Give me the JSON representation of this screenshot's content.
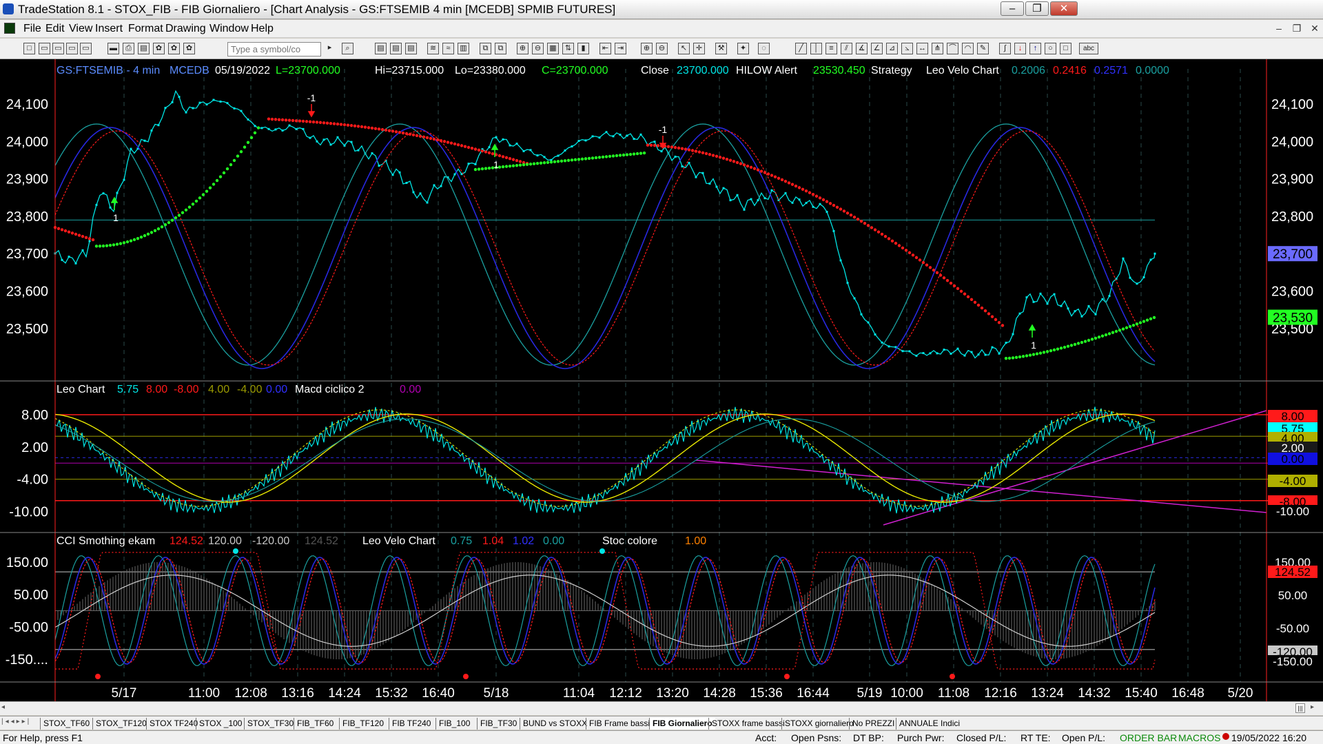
{
  "window": {
    "title": "TradeStation 8.1 - STOX_FIB - FIB Giornaliero - [Chart Analysis - GS:FTSEMIB  4 min  [MCEDB] SPMIB FUTURES]",
    "minimize": "–",
    "maximize": "❐",
    "close": "✕"
  },
  "menu": [
    "File",
    "Edit",
    "View",
    "Insert",
    "Format",
    "Drawing",
    "Window",
    "Help"
  ],
  "mdi": {
    "minimize": "–",
    "restore": "❐",
    "close": "✕"
  },
  "toolbar": {
    "symbol_placeholder": "Type a symbol/co",
    "abc": "abc"
  },
  "colors": {
    "bg": "#000000",
    "cyan": "#00e5e5",
    "teal": "#1aa0a0",
    "blue": "#2828e0",
    "red": "#ff1a1a",
    "green": "#22ff22",
    "yellow": "#e8e800",
    "magenta": "#d020d0",
    "olive": "#9a9a00",
    "orange": "#ff8000"
  },
  "price_pane": {
    "header": [
      {
        "text": "GS:FTSEMIB - 4 min",
        "color": "#5b8cff"
      },
      {
        "text": "MCEDB",
        "color": "#5b8cff"
      },
      {
        "text": "05/19/2022",
        "color": "#ffffff"
      },
      {
        "text": "L=23700.000",
        "color": "#22ff22"
      },
      {
        "text": "Hi=23715.000",
        "color": "#ffffff"
      },
      {
        "text": "Lo=23380.000",
        "color": "#ffffff"
      },
      {
        "text": "C=23700.000",
        "color": "#22ff22"
      },
      {
        "text": "Close",
        "color": "#ffffff"
      },
      {
        "text": "23700.000",
        "color": "#00e5e5"
      },
      {
        "text": "HILOW Alert",
        "color": "#ffffff"
      },
      {
        "text": "23530.450",
        "color": "#22ff22"
      },
      {
        "text": "Strategy",
        "color": "#ffffff"
      },
      {
        "text": "Leo Velo Chart",
        "color": "#ffffff"
      },
      {
        "text": "0.2006",
        "color": "#1aa0a0"
      },
      {
        "text": "0.2416",
        "color": "#ff1a1a"
      },
      {
        "text": "0.2571",
        "color": "#3030ff"
      },
      {
        "text": "0.0000",
        "color": "#1aa0a0"
      }
    ],
    "y_ticks": [
      "24,100",
      "24,000",
      "23,900",
      "23,800",
      "23,700",
      "23,600",
      "23,500"
    ],
    "last_price": "23,700",
    "stop_value": "23,530",
    "strategy_marks": [
      {
        "label": "1",
        "dir": "up"
      },
      {
        "label": "-1",
        "dir": "down"
      },
      {
        "label": "1",
        "dir": "up"
      },
      {
        "label": "-1",
        "dir": "down"
      },
      {
        "label": "1",
        "dir": "up"
      }
    ]
  },
  "osc_pane": {
    "header": [
      {
        "text": "Leo Chart",
        "color": "#ffffff"
      },
      {
        "text": "5.75",
        "color": "#00e5e5"
      },
      {
        "text": "8.00",
        "color": "#ff1a1a"
      },
      {
        "text": "-8.00",
        "color": "#ff1a1a"
      },
      {
        "text": "4.00",
        "color": "#9a9a00"
      },
      {
        "text": "-4.00",
        "color": "#9a9a00"
      },
      {
        "text": "0.00",
        "color": "#3030ff"
      },
      {
        "text": "Macd ciclico 2",
        "color": "#ffffff"
      },
      {
        "text": "0.00",
        "color": "#b000b0"
      }
    ],
    "y_ticks": [
      "8.00",
      "2.00",
      "-4.00",
      "-10.00"
    ],
    "right_tags": [
      {
        "text": "8.00",
        "bg": "#ff1a1a",
        "fg": "#000000"
      },
      {
        "text": "5.75",
        "bg": "#00ffff",
        "fg": "#000000"
      },
      {
        "text": "4.00",
        "bg": "#b0b000",
        "fg": "#000000"
      },
      {
        "text": "2.00",
        "bg": "#1a1a1a",
        "fg": "#ffffff"
      },
      {
        "text": "0.00",
        "bg": "#1010e0",
        "fg": "#000000"
      },
      {
        "text": "-4.00",
        "bg": "#b0b000",
        "fg": "#000000"
      },
      {
        "text": "-8.00",
        "bg": "#ff1a1a",
        "fg": "#000000"
      },
      {
        "text": "-10.00",
        "bg": "#000000",
        "fg": "#ffffff"
      }
    ]
  },
  "cci_pane": {
    "header": [
      {
        "text": "CCI Smothing ekam",
        "color": "#ffffff"
      },
      {
        "text": "124.52",
        "color": "#ff1a1a"
      },
      {
        "text": "120.00",
        "color": "#c8c8c8"
      },
      {
        "text": "-120.00",
        "color": "#c8c8c8"
      },
      {
        "text": "124.52",
        "color": "#555555"
      },
      {
        "text": "Leo Velo Chart",
        "color": "#ffffff"
      },
      {
        "text": "0.75",
        "color": "#1aa0a0"
      },
      {
        "text": "1.04",
        "color": "#ff1a1a"
      },
      {
        "text": "1.02",
        "color": "#3030ff"
      },
      {
        "text": "0.00",
        "color": "#1aa0a0"
      },
      {
        "text": "Stoc colore",
        "color": "#ffffff"
      },
      {
        "text": "1.00",
        "color": "#ff8000"
      }
    ],
    "y_ticks": [
      "150.00",
      "50.00",
      "-50.00",
      "-150...."
    ],
    "right_tags": [
      {
        "text": "150.00",
        "bg": "#000000",
        "fg": "#ffffff"
      },
      {
        "text": "124.52",
        "bg": "#ff1a1a",
        "fg": "#000000"
      },
      {
        "text": "50.00",
        "bg": "#000000",
        "fg": "#ffffff"
      },
      {
        "text": "-50.00",
        "bg": "#000000",
        "fg": "#ffffff"
      },
      {
        "text": "-120.00",
        "bg": "#c8c8c8",
        "fg": "#000000"
      },
      {
        "text": "-150.00",
        "bg": "#000000",
        "fg": "#ffffff"
      }
    ]
  },
  "time_axis": [
    "5/17",
    "11:00",
    "12:08",
    "13:16",
    "14:24",
    "15:32",
    "16:40",
    "5/18",
    "11:04",
    "12:12",
    "13:20",
    "14:28",
    "15:36",
    "16:44",
    "5/19",
    "10:00",
    "11:08",
    "12:16",
    "13:24",
    "14:32",
    "15:40",
    "16:48",
    "5/20"
  ],
  "tabs": [
    "STOX_TF60",
    "STOX_TF120",
    "STOX TF240",
    "STOX _100",
    "STOX_TF30",
    "FIB_TF60",
    "FIB_TF120",
    "FIB TF240",
    "FIB_100",
    "FIB_TF30",
    "BUND vs STOXX",
    "FIB Frame bassi",
    "FIB Giornaliero",
    "STOXX frame bassi",
    "STOXX giornaliero",
    "No PREZZI",
    "ANNUALE Indici"
  ],
  "active_tab": "FIB Giornaliero",
  "status": {
    "help": "For Help, press F1",
    "acct": "Acct:",
    "open_psns": "Open Psns:",
    "dt_bp": "DT BP:",
    "purch_pwr": "Purch Pwr:",
    "closed_pl": "Closed P/L:",
    "rt_te": "RT TE:",
    "open_pl": "Open P/L:",
    "order_bar": "ORDER BAR",
    "macros": "MACROS",
    "datetime": "19/05/2022 16:20"
  }
}
